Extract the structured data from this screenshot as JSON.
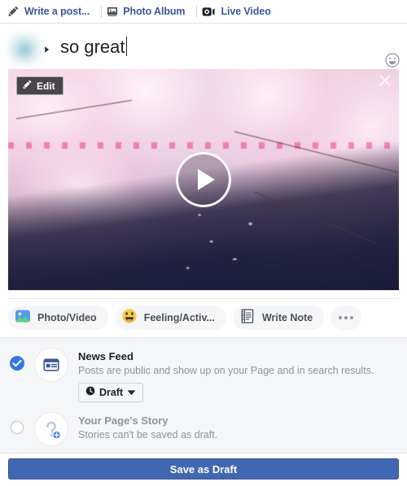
{
  "tabs": [
    {
      "label": "Write a post...",
      "icon": "pencil-icon",
      "active": true
    },
    {
      "label": "Photo Album",
      "icon": "photo-album-icon",
      "active": false
    },
    {
      "label": "Live Video",
      "icon": "live-video-icon",
      "active": false
    }
  ],
  "composer": {
    "post_text": "so great",
    "placeholder": "Write a post...",
    "emoji_button": "emoji-smiley-icon"
  },
  "media": {
    "type": "video",
    "description": "Cherry blossom trees in full bloom arching over a narrow canal with petals on the dark water",
    "edit_label": "Edit",
    "edit_icon": "pencil-icon",
    "close_icon": "close-icon",
    "play_icon": "play-icon"
  },
  "attachments": [
    {
      "label": "Photo/Video",
      "icon": "photo-video-icon"
    },
    {
      "label": "Feeling/Activ...",
      "icon": "feeling-activity-icon"
    },
    {
      "label": "Write Note",
      "icon": "write-note-icon"
    }
  ],
  "attachments_more": {
    "label": "More options",
    "icon": "ellipsis-icon"
  },
  "destinations": [
    {
      "title": "News Feed",
      "subtitle": "Posts are public and show up on your Page and in search results.",
      "selected": true,
      "icon": "news-feed-icon",
      "schedule": {
        "label": "Draft",
        "icon": "clock-icon",
        "caret": "chevron-down-icon"
      }
    },
    {
      "title": "Your Page's Story",
      "subtitle": "Stories can't be saved as draft.",
      "selected": false,
      "disabled": true,
      "icon": "add-story-icon"
    }
  ],
  "footer": {
    "save_label": "Save as Draft"
  },
  "colors": {
    "brand_blue": "#4267b2",
    "link_blue": "#3b5998",
    "panel_bg": "#f5f6f7",
    "muted_text": "#8d949e",
    "primary_text": "#1d2129"
  }
}
